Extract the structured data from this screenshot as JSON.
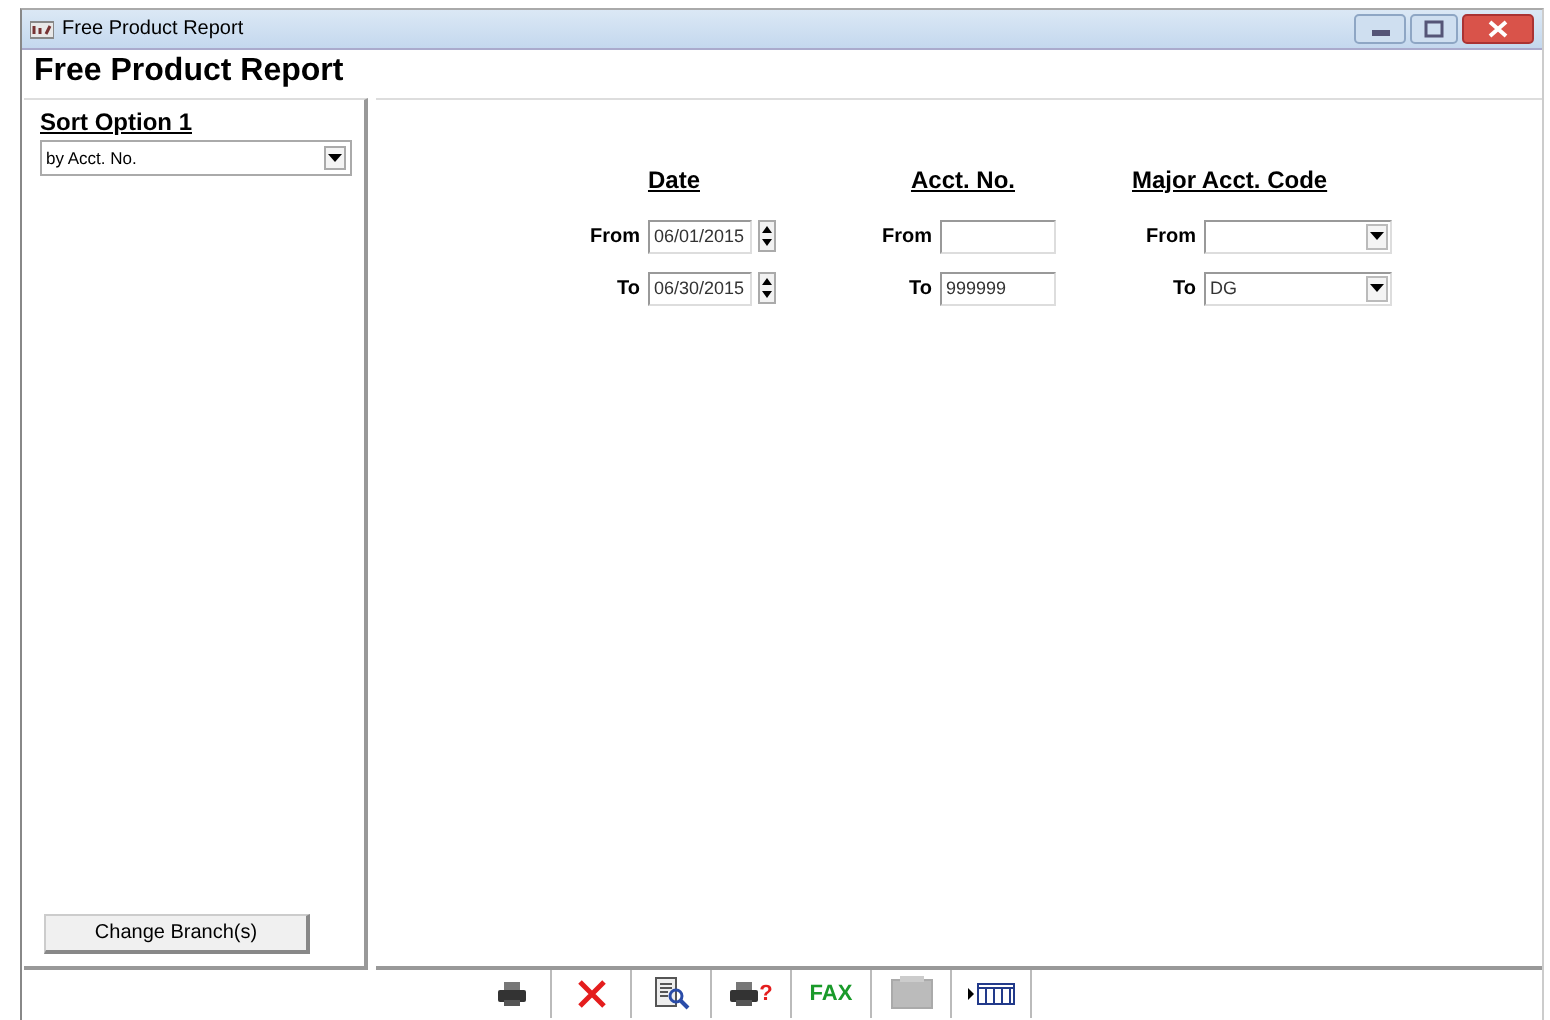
{
  "window": {
    "title": "Free Product Report"
  },
  "report_title": "Free Product Report",
  "sort_panel": {
    "heading": "Sort Option 1",
    "sort_by": {
      "value": "by Acct. No."
    },
    "button": "Change Branch(s)"
  },
  "criteria": [
    {
      "kind": "date",
      "heading": "Date",
      "rows": [
        {
          "label": "From",
          "value": "06/01/2015"
        },
        {
          "label": "To",
          "value": "06/30/2015"
        }
      ]
    },
    {
      "kind": "text",
      "heading": "Acct. No.",
      "rows": [
        {
          "label": "From"
        },
        {
          "label": "To",
          "value": "999999"
        }
      ]
    },
    {
      "kind": "dropdown",
      "heading": "Major Acct. Code",
      "rows": [
        {
          "label": "From"
        },
        {
          "label": "To",
          "value": "DG"
        }
      ]
    }
  ],
  "toolbar": [
    {
      "kind": "print"
    },
    {
      "kind": "cancel"
    },
    {
      "kind": "preview"
    },
    {
      "kind": "print-query",
      "label": "?"
    },
    {
      "kind": "fax",
      "label": "FAX"
    },
    {
      "kind": "blank"
    },
    {
      "kind": "columns"
    }
  ]
}
